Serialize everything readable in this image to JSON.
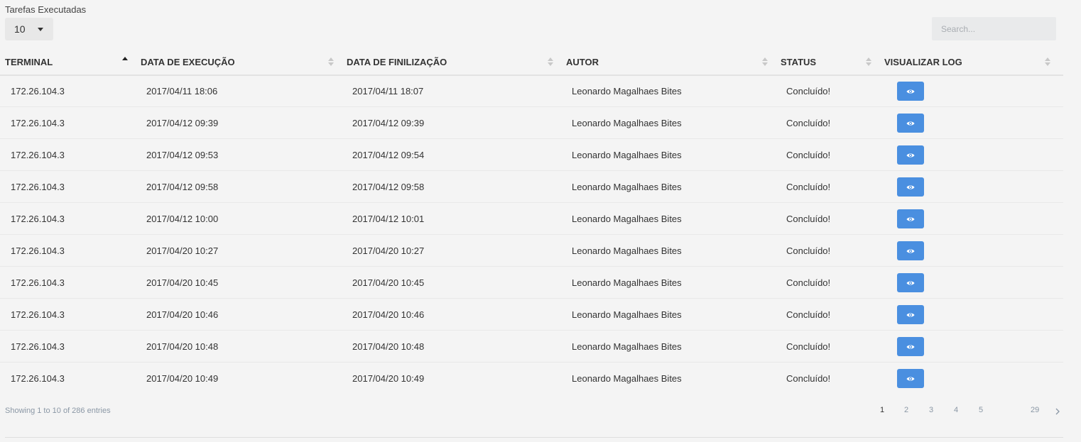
{
  "header": {
    "title": "Tarefas Executadas"
  },
  "length_menu": {
    "selected": "10"
  },
  "search": {
    "placeholder": "Search..."
  },
  "table": {
    "columns": [
      "TERMINAL",
      "DATA DE EXECUÇÃO",
      "DATA DE FINILIZAÇÃO",
      "AUTOR",
      "STATUS",
      "VISUALIZAR LOG"
    ],
    "sorted_column": "TERMINAL",
    "sort_direction": "asc",
    "rows": [
      {
        "terminal": "172.26.104.3",
        "execucao": "2017/04/11 18:06",
        "finalizacao": "2017/04/11 18:07",
        "autor": "Leonardo Magalhaes Bites",
        "status": "Concluído!"
      },
      {
        "terminal": "172.26.104.3",
        "execucao": "2017/04/12 09:39",
        "finalizacao": "2017/04/12 09:39",
        "autor": "Leonardo Magalhaes Bites",
        "status": "Concluído!"
      },
      {
        "terminal": "172.26.104.3",
        "execucao": "2017/04/12 09:53",
        "finalizacao": "2017/04/12 09:54",
        "autor": "Leonardo Magalhaes Bites",
        "status": "Concluído!"
      },
      {
        "terminal": "172.26.104.3",
        "execucao": "2017/04/12 09:58",
        "finalizacao": "2017/04/12 09:58",
        "autor": "Leonardo Magalhaes Bites",
        "status": "Concluído!"
      },
      {
        "terminal": "172.26.104.3",
        "execucao": "2017/04/12 10:00",
        "finalizacao": "2017/04/12 10:01",
        "autor": "Leonardo Magalhaes Bites",
        "status": "Concluído!"
      },
      {
        "terminal": "172.26.104.3",
        "execucao": "2017/04/20 10:27",
        "finalizacao": "2017/04/20 10:27",
        "autor": "Leonardo Magalhaes Bites",
        "status": "Concluído!"
      },
      {
        "terminal": "172.26.104.3",
        "execucao": "2017/04/20 10:45",
        "finalizacao": "2017/04/20 10:45",
        "autor": "Leonardo Magalhaes Bites",
        "status": "Concluído!"
      },
      {
        "terminal": "172.26.104.3",
        "execucao": "2017/04/20 10:46",
        "finalizacao": "2017/04/20 10:46",
        "autor": "Leonardo Magalhaes Bites",
        "status": "Concluído!"
      },
      {
        "terminal": "172.26.104.3",
        "execucao": "2017/04/20 10:48",
        "finalizacao": "2017/04/20 10:48",
        "autor": "Leonardo Magalhaes Bites",
        "status": "Concluído!"
      },
      {
        "terminal": "172.26.104.3",
        "execucao": "2017/04/20 10:49",
        "finalizacao": "2017/04/20 10:49",
        "autor": "Leonardo Magalhaes Bites",
        "status": "Concluído!"
      }
    ],
    "view_icon": "eye-icon"
  },
  "footer": {
    "info": "Showing 1 to 10 of 286 entries",
    "pages": [
      "1",
      "2",
      "3",
      "4",
      "5",
      "29"
    ],
    "active_page": "1"
  },
  "colors": {
    "accent": "#4a8fe0",
    "background": "#f4f4f4",
    "muted_text": "#8a97a5"
  }
}
